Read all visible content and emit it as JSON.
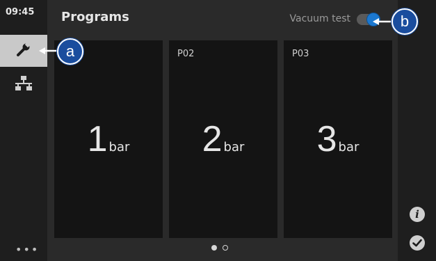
{
  "status": {
    "time": "09:45"
  },
  "header": {
    "title": "Programs",
    "vacuum_test_label": "Vacuum test",
    "vacuum_test_enabled": true
  },
  "sidebar": {
    "items": [
      {
        "icon": "wrench-icon",
        "active": true
      },
      {
        "icon": "network-icon",
        "active": false
      }
    ],
    "more": "•••"
  },
  "programs": [
    {
      "label": "",
      "value": "1",
      "unit": "bar"
    },
    {
      "label": "P02",
      "value": "2",
      "unit": "bar"
    },
    {
      "label": "P03",
      "value": "3",
      "unit": "bar"
    }
  ],
  "pagination": {
    "current_page": 1,
    "total_pages": 2
  },
  "callouts": {
    "a": "a",
    "b": "b"
  },
  "colors": {
    "accent": "#1b78d0",
    "callout": "#1a4d9e",
    "background": "#1c1c1c"
  }
}
